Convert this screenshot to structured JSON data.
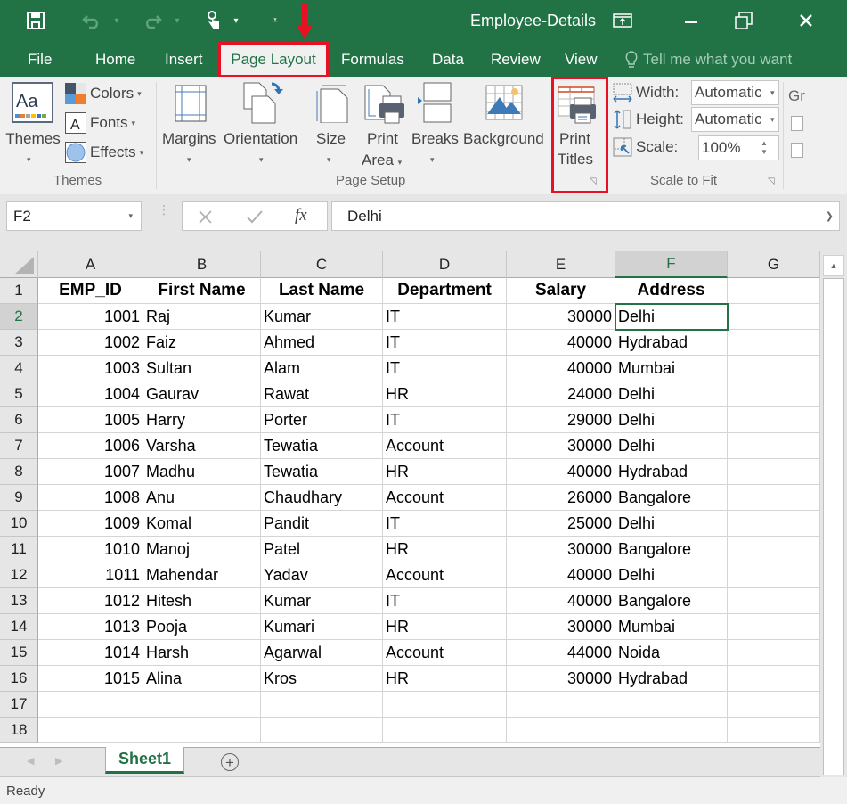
{
  "window": {
    "title": "Employee-Details",
    "controls": [
      "ribbon-display-options",
      "minimize",
      "restore",
      "close"
    ]
  },
  "quick_access": {
    "icons": [
      "save-icon",
      "undo-icon",
      "redo-icon",
      "touch-mode-icon",
      "customize-qat-icon"
    ]
  },
  "tabs": {
    "file": "File",
    "home": "Home",
    "insert": "Insert",
    "page_layout": "Page Layout",
    "formulas": "Formulas",
    "data": "Data",
    "review": "Review",
    "view": "View",
    "tell_me": "Tell me what you want",
    "active": "Page Layout"
  },
  "ribbon": {
    "themes_group": {
      "themes": "Themes",
      "colors": "Colors",
      "fonts": "Fonts",
      "effects": "Effects",
      "label": "Themes"
    },
    "page_setup_group": {
      "margins": "Margins",
      "orientation": "Orientation",
      "size": "Size",
      "print_area_1": "Print",
      "print_area_2": "Area",
      "breaks": "Breaks",
      "background": "Background",
      "print_titles_1": "Print",
      "print_titles_2": "Titles",
      "label": "Page Setup"
    },
    "scale_group": {
      "width_label": "Width:",
      "width_value": "Automatic",
      "height_label": "Height:",
      "height_value": "Automatic",
      "scale_label": "Scale:",
      "scale_value": "100%",
      "label": "Scale to Fit"
    },
    "sheet_options_partial": "Gr"
  },
  "formula_bar": {
    "name_box": "F2",
    "formula": "Delhi",
    "fx": "fx"
  },
  "columns": [
    "A",
    "B",
    "C",
    "D",
    "E",
    "F",
    "G"
  ],
  "selected_column": "F",
  "selected_row": 2,
  "rows": [
    "1",
    "2",
    "3",
    "4",
    "5",
    "6",
    "7",
    "8",
    "9",
    "10",
    "11",
    "12",
    "13",
    "14",
    "15",
    "16",
    "17",
    "18"
  ],
  "sheet": {
    "headers": [
      "EMP_ID",
      "First Name",
      "Last Name",
      "Department",
      "Salary",
      "Address"
    ],
    "data": [
      [
        "1001",
        "Raj",
        "Kumar",
        "IT",
        "30000",
        "Delhi"
      ],
      [
        "1002",
        "Faiz",
        "Ahmed",
        "IT",
        "40000",
        "Hydrabad"
      ],
      [
        "1003",
        "Sultan",
        "Alam",
        "IT",
        "40000",
        "Mumbai"
      ],
      [
        "1004",
        "Gaurav",
        "Rawat",
        "HR",
        "24000",
        "Delhi"
      ],
      [
        "1005",
        "Harry",
        "Porter",
        "IT",
        "29000",
        "Delhi"
      ],
      [
        "1006",
        "Varsha",
        "Tewatia",
        "Account",
        "30000",
        "Delhi"
      ],
      [
        "1007",
        "Madhu",
        "Tewatia",
        "HR",
        "40000",
        "Hydrabad"
      ],
      [
        "1008",
        "Anu",
        "Chaudhary",
        "Account",
        "26000",
        "Bangalore"
      ],
      [
        "1009",
        "Komal",
        "Pandit",
        "IT",
        "25000",
        "Delhi"
      ],
      [
        "1010",
        "Manoj",
        "Patel",
        "HR",
        "30000",
        "Bangalore"
      ],
      [
        "1011",
        "Mahendar",
        "Yadav",
        "Account",
        "40000",
        "Delhi"
      ],
      [
        "1012",
        "Hitesh",
        "Kumar",
        "IT",
        "40000",
        "Bangalore"
      ],
      [
        "1013",
        "Pooja",
        "Kumari",
        "HR",
        "30000",
        "Mumbai"
      ],
      [
        "1014",
        "Harsh",
        "Agarwal",
        "Account",
        "44000",
        "Noida"
      ],
      [
        "1015",
        "Alina",
        "Kros",
        "HR",
        "30000",
        "Hydrabad"
      ]
    ]
  },
  "sheet_tabs": {
    "active": "Sheet1"
  },
  "status": {
    "text": "Ready"
  },
  "colors": {
    "brand": "#217346",
    "highlight": "#e81123"
  }
}
